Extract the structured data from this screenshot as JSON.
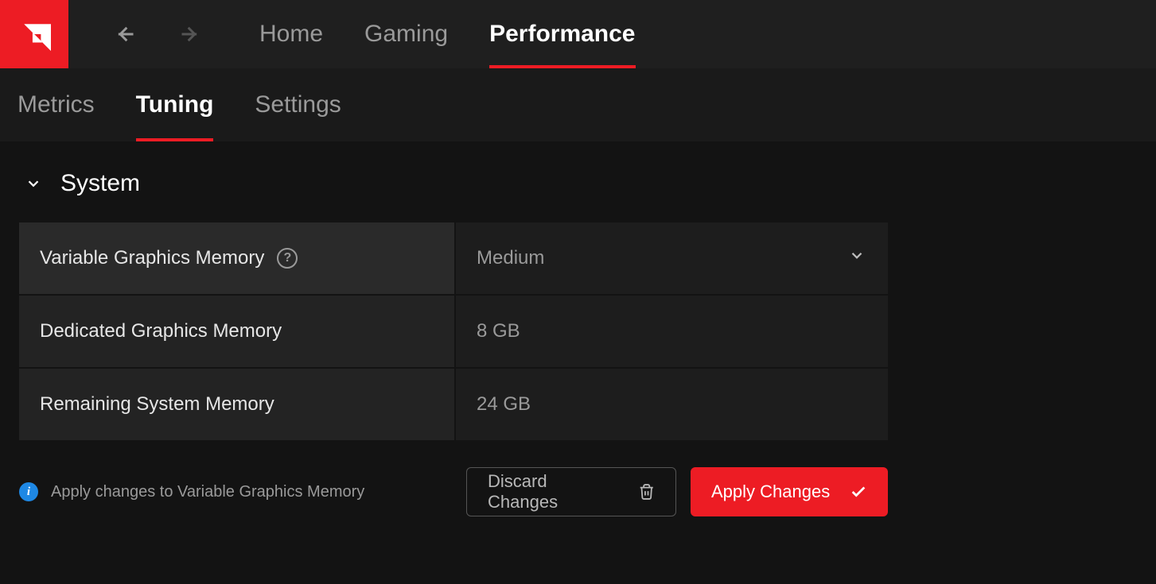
{
  "header": {
    "tabs": [
      {
        "label": "Home",
        "active": false
      },
      {
        "label": "Gaming",
        "active": false
      },
      {
        "label": "Performance",
        "active": true
      }
    ]
  },
  "subheader": {
    "tabs": [
      {
        "label": "Metrics",
        "active": false
      },
      {
        "label": "Tuning",
        "active": true
      },
      {
        "label": "Settings",
        "active": false
      }
    ]
  },
  "section": {
    "title": "System",
    "rows": [
      {
        "label": "Variable Graphics Memory",
        "value": "Medium",
        "type": "dropdown",
        "help": true
      },
      {
        "label": "Dedicated Graphics Memory",
        "value": "8 GB",
        "type": "readonly",
        "help": false
      },
      {
        "label": "Remaining System Memory",
        "value": "24 GB",
        "type": "readonly",
        "help": false
      }
    ]
  },
  "footer": {
    "info_text": "Apply changes to Variable Graphics Memory",
    "discard_label": "Discard Changes",
    "apply_label": "Apply Changes"
  },
  "colors": {
    "accent": "#ed1c24",
    "info": "#1e88e5"
  }
}
